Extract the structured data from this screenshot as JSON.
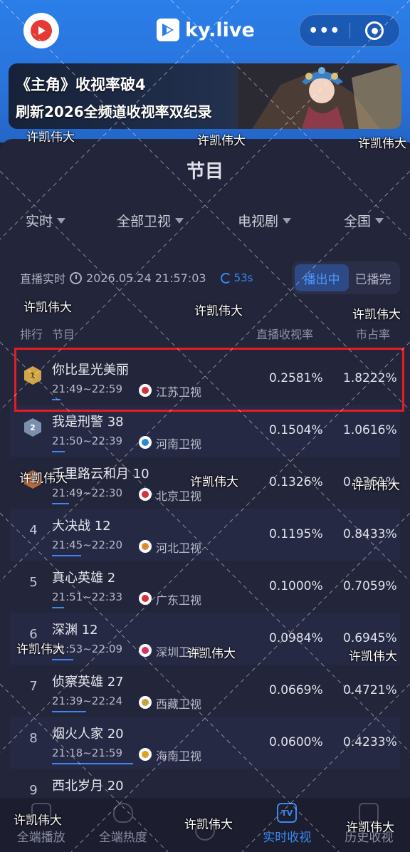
{
  "header": {
    "brand": "ky.live",
    "more_glyph": "•••",
    "icons": [
      "app-logo-icon",
      "ky-live-logo-icon",
      "more-icon",
      "target-icon"
    ]
  },
  "banner": {
    "line1": "《主角》收视率破4",
    "line2": "刷新2026全频道收视率双纪录"
  },
  "panel": {
    "title": "节目"
  },
  "filters": [
    {
      "label": "实时"
    },
    {
      "label": "全部卫视"
    },
    {
      "label": "电视剧"
    },
    {
      "label": "全国"
    }
  ],
  "status": {
    "label": "直播实时",
    "datetime": "2026.05.24 21:57:03",
    "refresh": "53s"
  },
  "toggle": {
    "on": "播出中",
    "off": "已播完"
  },
  "table_headers": {
    "rank": "排行",
    "program": "节目",
    "rating": "直播收视率",
    "share": "市占率"
  },
  "rows": [
    {
      "rank": "1",
      "title": "你比星光美丽",
      "time": "21:49~22:59",
      "channel": "江苏卫视",
      "rating": "0.2581%",
      "share": "1.8222%",
      "progress": 0.1,
      "channel_color": "#d6303a"
    },
    {
      "rank": "2",
      "title": "我是刑警 38",
      "time": "21:50~22:39",
      "channel": "河南卫视",
      "rating": "0.1504%",
      "share": "1.0616%",
      "progress": 0.15,
      "channel_color": "#2a8ad8"
    },
    {
      "rank": "3",
      "title": "千里路云和月 10",
      "time": "21:49~22:30",
      "channel": "北京卫视",
      "rating": "0.1326%",
      "share": "0.9361%",
      "progress": 0.2,
      "channel_color": "#d6303a"
    },
    {
      "rank": "4",
      "title": "大决战 12",
      "time": "21:45~22:20",
      "channel": "河北卫视",
      "rating": "0.1195%",
      "share": "0.8433%",
      "progress": 0.34,
      "channel_color": "#e08a2a"
    },
    {
      "rank": "5",
      "title": "真心英雄 2",
      "time": "21:51~22:33",
      "channel": "广东卫视",
      "rating": "0.1000%",
      "share": "0.7059%",
      "progress": 0.14,
      "channel_color": "#d6303a"
    },
    {
      "rank": "6",
      "title": "深渊 12",
      "time": "21:53~22:09",
      "channel": "深圳卫视",
      "rating": "0.0984%",
      "share": "0.6945%",
      "progress": 0.25,
      "channel_color": "#d6306a"
    },
    {
      "rank": "7",
      "title": "侦察英雄 27",
      "time": "21:39~22:24",
      "channel": "西藏卫视",
      "rating": "0.0669%",
      "share": "0.4721%",
      "progress": 0.4,
      "channel_color": "#c8a040"
    },
    {
      "rank": "8",
      "title": "烟火人家 20",
      "time": "21:18~21:59",
      "channel": "海南卫视",
      "rating": "0.0600%",
      "share": "0.4233%",
      "progress": 0.95,
      "channel_color": "#e0a020"
    },
    {
      "rank": "9",
      "title": "西北岁月 20",
      "time": "",
      "channel": "",
      "rating": "",
      "share": "",
      "progress": 0,
      "channel_color": "#888888"
    }
  ],
  "tabs": [
    {
      "label": "全端播放",
      "active": false
    },
    {
      "label": "全端热度",
      "active": false
    },
    {
      "label": "",
      "active": false
    },
    {
      "label": "实时收视",
      "active": true,
      "icon_text": "TV"
    },
    {
      "label": "历史收视",
      "active": false
    }
  ],
  "watermark": "许凯伟大",
  "accent_color": "#3a88f0",
  "highlight_color": "#e41c24"
}
